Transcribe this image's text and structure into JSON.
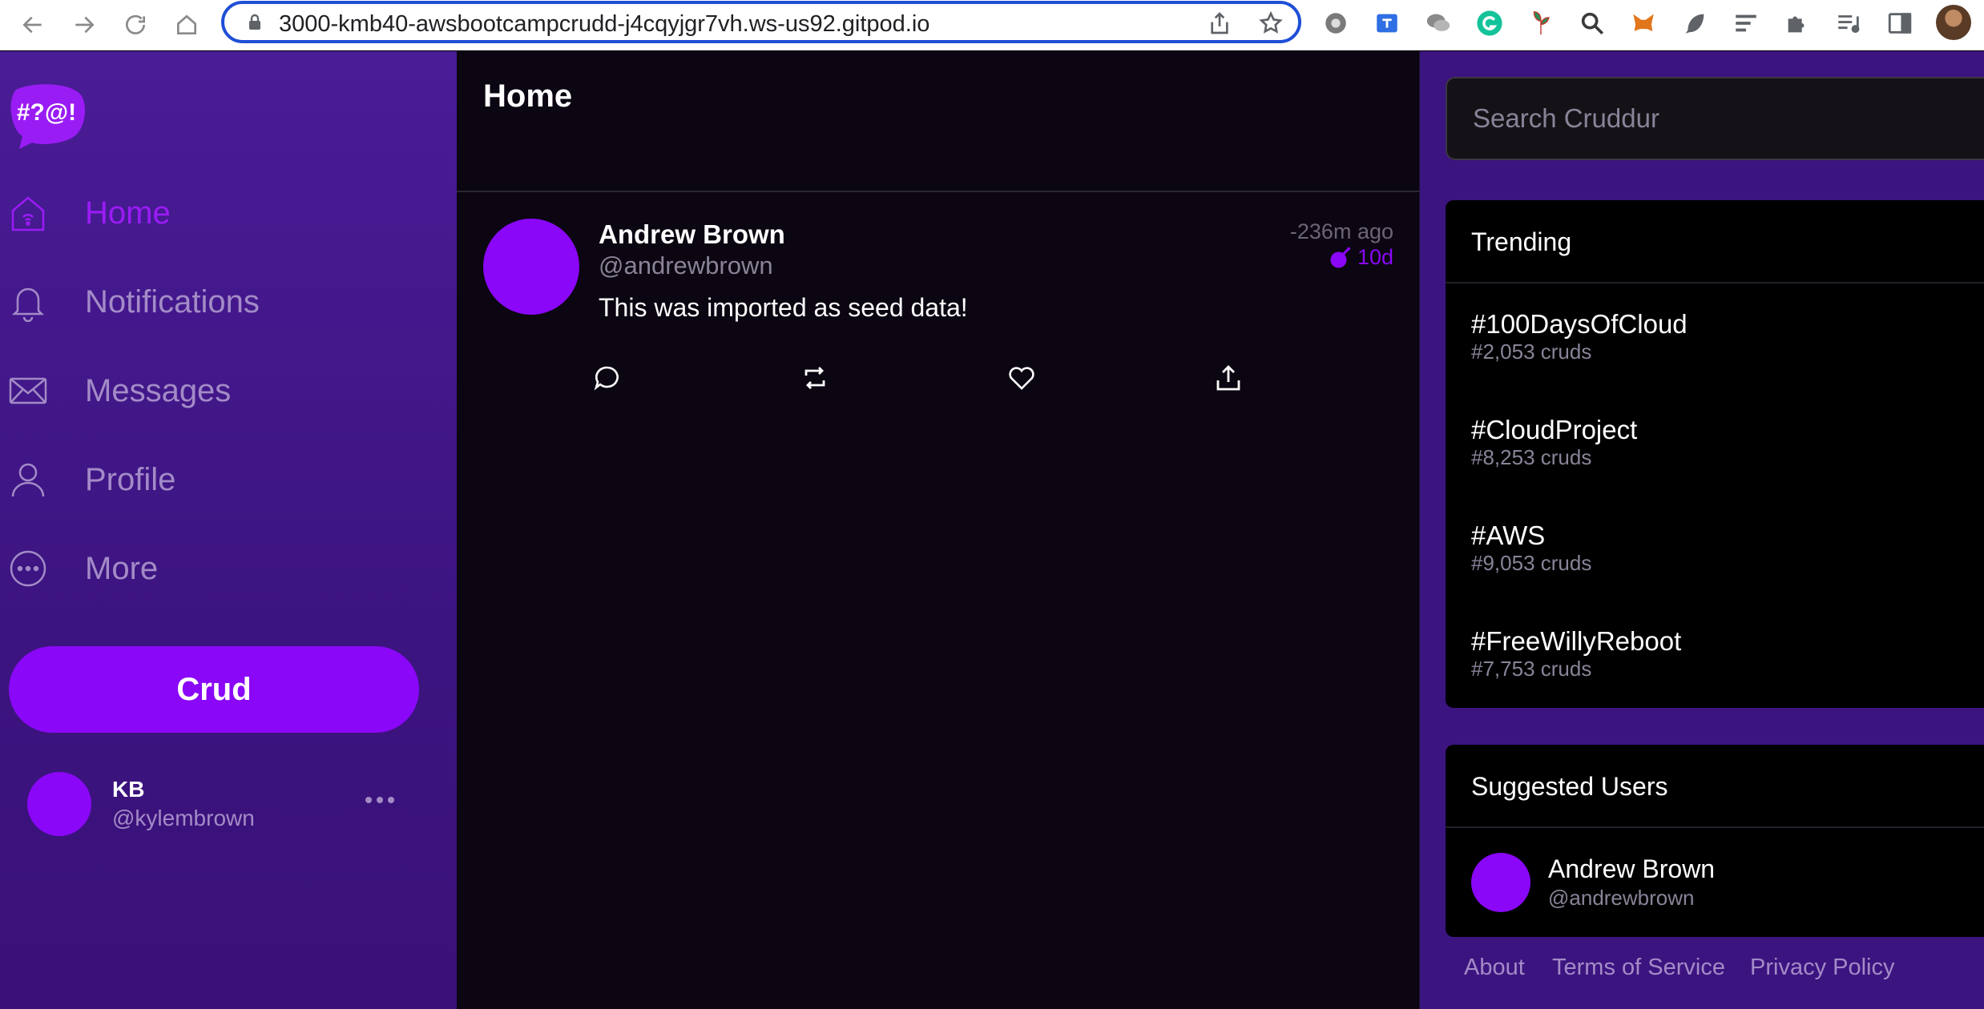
{
  "browser": {
    "url": "3000-kmb40-awsbootcampcrudd-j4cqyjgr7vh.ws-us92.gitpod.io",
    "extensions": [
      "settings-gear",
      "translate",
      "chat",
      "grammarly",
      "plant",
      "magnifier",
      "metamask",
      "feather",
      "list",
      "puzzle",
      "media-list",
      "sidebar"
    ]
  },
  "sidebar": {
    "logo_text": "#?@!",
    "items": [
      {
        "label": "Home",
        "icon": "home-icon",
        "active": true
      },
      {
        "label": "Notifications",
        "icon": "bell-icon",
        "active": false
      },
      {
        "label": "Messages",
        "icon": "mail-icon",
        "active": false
      },
      {
        "label": "Profile",
        "icon": "person-icon",
        "active": false
      },
      {
        "label": "More",
        "icon": "more-circle-icon",
        "active": false
      }
    ],
    "crud_label": "Crud",
    "profile": {
      "name": "KB",
      "handle": "@kylembrown"
    }
  },
  "feed": {
    "title": "Home",
    "activities": [
      {
        "display_name": "Andrew Brown",
        "handle": "@andrewbrown",
        "time": "-236m ago",
        "expires": "10d",
        "message": "This was imported as seed data!"
      }
    ]
  },
  "right": {
    "search_placeholder": "Search Cruddur",
    "trending_title": "Trending",
    "trending": [
      {
        "tag": "#100DaysOfCloud",
        "count": "#2,053 cruds"
      },
      {
        "tag": "#CloudProject",
        "count": "#8,253 cruds"
      },
      {
        "tag": "#AWS",
        "count": "#9,053 cruds"
      },
      {
        "tag": "#FreeWillyReboot",
        "count": "#7,753 cruds"
      }
    ],
    "suggested_title": "Suggested Users",
    "suggested": [
      {
        "name": "Andrew Brown",
        "handle": "@andrewbrown"
      }
    ],
    "footer": [
      "About",
      "Terms of Service",
      "Privacy Policy"
    ]
  },
  "colors": {
    "accent": "#8a07f7",
    "sidebar_bg": "#3c1480",
    "feed_bg": "#0b0611",
    "muted_text": "#a38bc7"
  }
}
